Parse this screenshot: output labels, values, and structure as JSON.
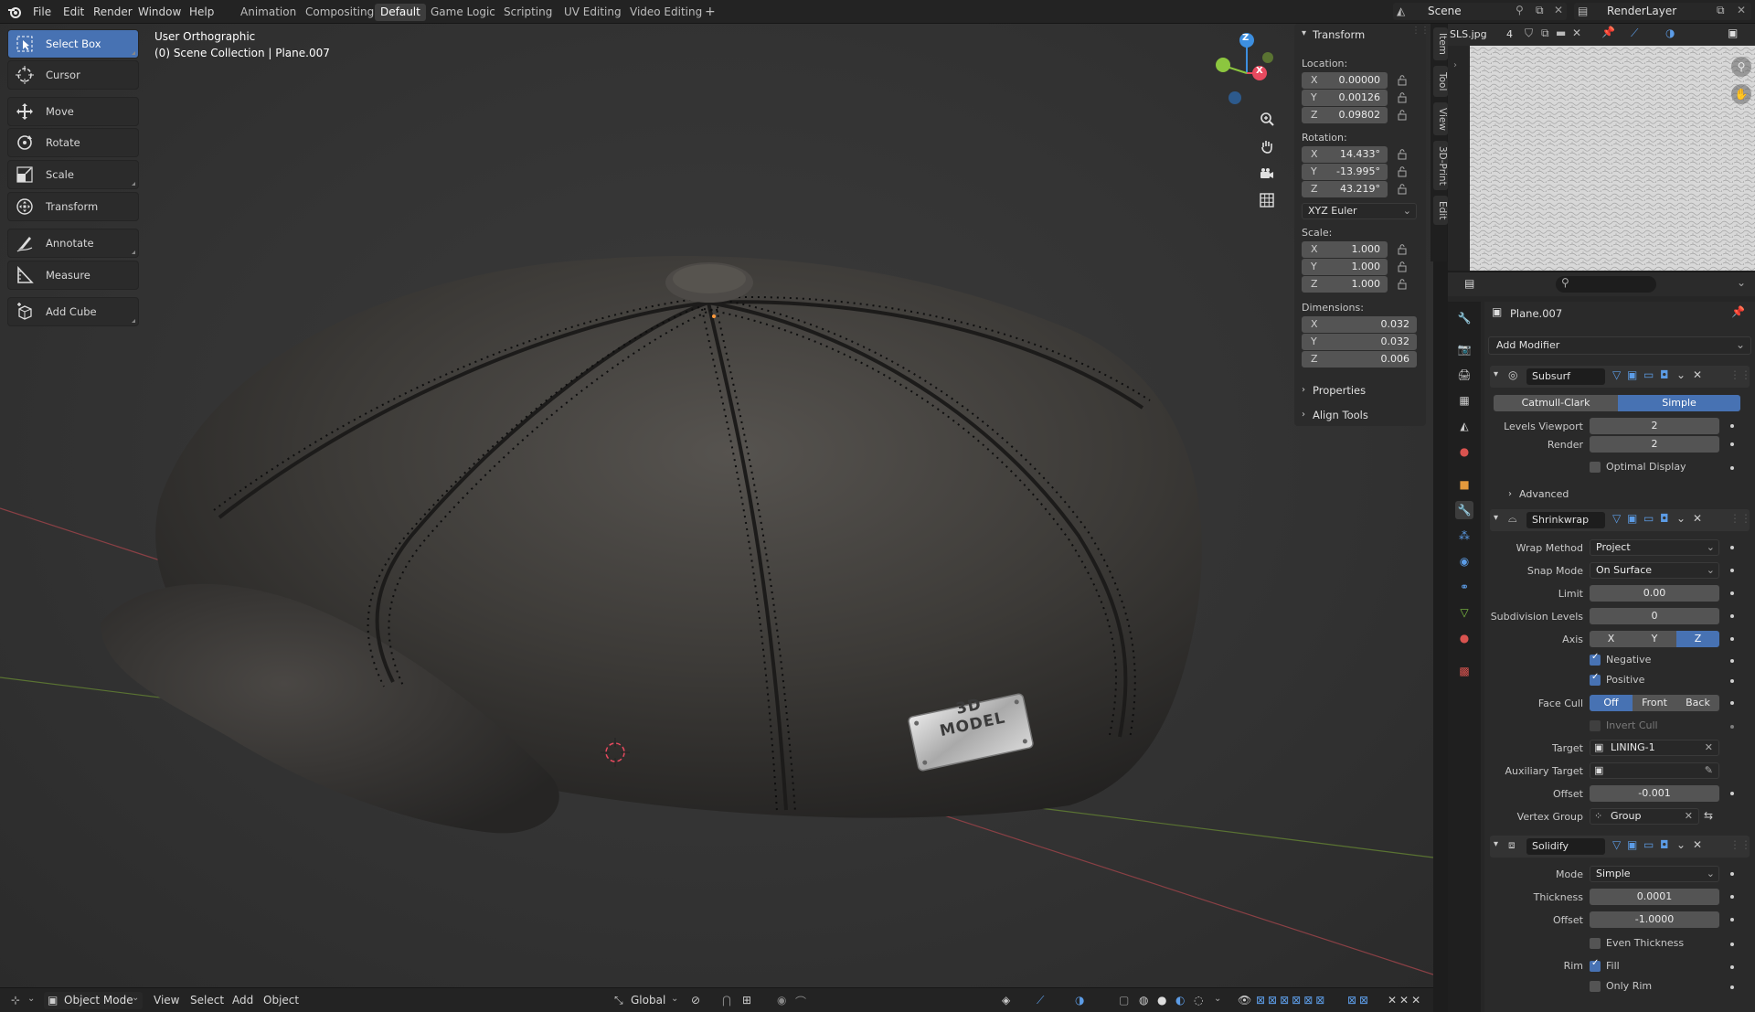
{
  "topbar": {
    "menus": [
      "File",
      "Edit",
      "Render",
      "Window",
      "Help"
    ],
    "workspaces": [
      "Animation",
      "Compositing",
      "Default",
      "Game Logic",
      "Scripting",
      "UV Editing",
      "Video Editing"
    ],
    "active_workspace": "Default",
    "add_workspace": "+",
    "scene": "Scene",
    "render_layer": "RenderLayer"
  },
  "viewport": {
    "view_name": "User Orthographic",
    "collection_path": "(0) Scene Collection | Plane.007",
    "badge_text": "3D MODEL",
    "gizmo": {
      "z": "Z",
      "x": "X"
    }
  },
  "toolbar": {
    "tools": [
      {
        "label": "Select Box",
        "icon": "select-box-icon",
        "active": true
      },
      {
        "label": "Cursor",
        "icon": "cursor-icon",
        "active": false
      },
      {
        "label": "Move",
        "icon": "move-icon",
        "active": false
      },
      {
        "label": "Rotate",
        "icon": "rotate-icon",
        "active": false
      },
      {
        "label": "Scale",
        "icon": "scale-icon",
        "active": false
      },
      {
        "label": "Transform",
        "icon": "transform-icon",
        "active": false
      },
      {
        "label": "Annotate",
        "icon": "annotate-icon",
        "active": false
      },
      {
        "label": "Measure",
        "icon": "measure-icon",
        "active": false
      },
      {
        "label": "Add Cube",
        "icon": "add-cube-icon",
        "active": false
      }
    ]
  },
  "npanel": {
    "title": "Transform",
    "location_label": "Location:",
    "location": [
      {
        "axis": "X",
        "value": "0.00000"
      },
      {
        "axis": "Y",
        "value": "0.00126"
      },
      {
        "axis": "Z",
        "value": "0.09802"
      }
    ],
    "rotation_label": "Rotation:",
    "rotation": [
      {
        "axis": "X",
        "value": "14.433°"
      },
      {
        "axis": "Y",
        "value": "-13.995°"
      },
      {
        "axis": "Z",
        "value": "43.219°"
      }
    ],
    "rotation_mode": "XYZ Euler",
    "scale_label": "Scale:",
    "scale": [
      {
        "axis": "X",
        "value": "1.000"
      },
      {
        "axis": "Y",
        "value": "1.000"
      },
      {
        "axis": "Z",
        "value": "1.000"
      }
    ],
    "dimensions_label": "Dimensions:",
    "dimensions": [
      {
        "axis": "X",
        "value": "0.032"
      },
      {
        "axis": "Y",
        "value": "0.032"
      },
      {
        "axis": "Z",
        "value": "0.006"
      }
    ],
    "properties": "Properties",
    "align_tools": "Align Tools",
    "tabs": [
      "Item",
      "Tool",
      "View",
      "3D-Print",
      "Edit"
    ]
  },
  "image_editor": {
    "image_name": "SLS.jpg",
    "users": "4"
  },
  "properties": {
    "object_name": "Plane.007",
    "add_modifier": "Add Modifier",
    "subsurf": {
      "name": "Subsurf",
      "types": [
        "Catmull-Clark",
        "Simple"
      ],
      "active_type": "Simple",
      "levels_viewport_label": "Levels Viewport",
      "levels_viewport": "2",
      "render_label": "Render",
      "render": "2",
      "optimal_display": "Optimal Display",
      "advanced": "Advanced"
    },
    "shrinkwrap": {
      "name": "Shrinkwrap",
      "wrap_method_label": "Wrap Method",
      "wrap_method": "Project",
      "snap_mode_label": "Snap Mode",
      "snap_mode": "On Surface",
      "limit_label": "Limit",
      "limit": "0.00",
      "subdiv_label": "Subdivision Levels",
      "subdiv": "0",
      "axis_label": "Axis",
      "axes": [
        "X",
        "Y",
        "Z"
      ],
      "active_axis": "Z",
      "negative": "Negative",
      "positive": "Positive",
      "face_cull_label": "Face Cull",
      "face_cull": [
        "Off",
        "Front",
        "Back"
      ],
      "active_face_cull": "Off",
      "invert_cull": "Invert Cull",
      "target_label": "Target",
      "target": "LINING-1",
      "aux_target_label": "Auxiliary Target",
      "offset_label": "Offset",
      "offset": "-0.001",
      "vertex_group_label": "Vertex Group",
      "vertex_group": "Group"
    },
    "solidify": {
      "name": "Solidify",
      "mode_label": "Mode",
      "mode": "Simple",
      "thickness_label": "Thickness",
      "thickness": "0.0001",
      "offset_label": "Offset",
      "offset": "-1.0000",
      "even_thickness": "Even Thickness",
      "rim_label": "Rim",
      "fill": "Fill",
      "only_rim": "Only Rim"
    }
  },
  "bottombar": {
    "mode": "Object Mode",
    "menus": [
      "View",
      "Select",
      "Add",
      "Object"
    ],
    "orientation": "Global"
  },
  "colors": {
    "accent": "#4772b3",
    "axis_x": "#e84a5f",
    "axis_y": "#8cc63f",
    "axis_z": "#3d8fe0"
  }
}
